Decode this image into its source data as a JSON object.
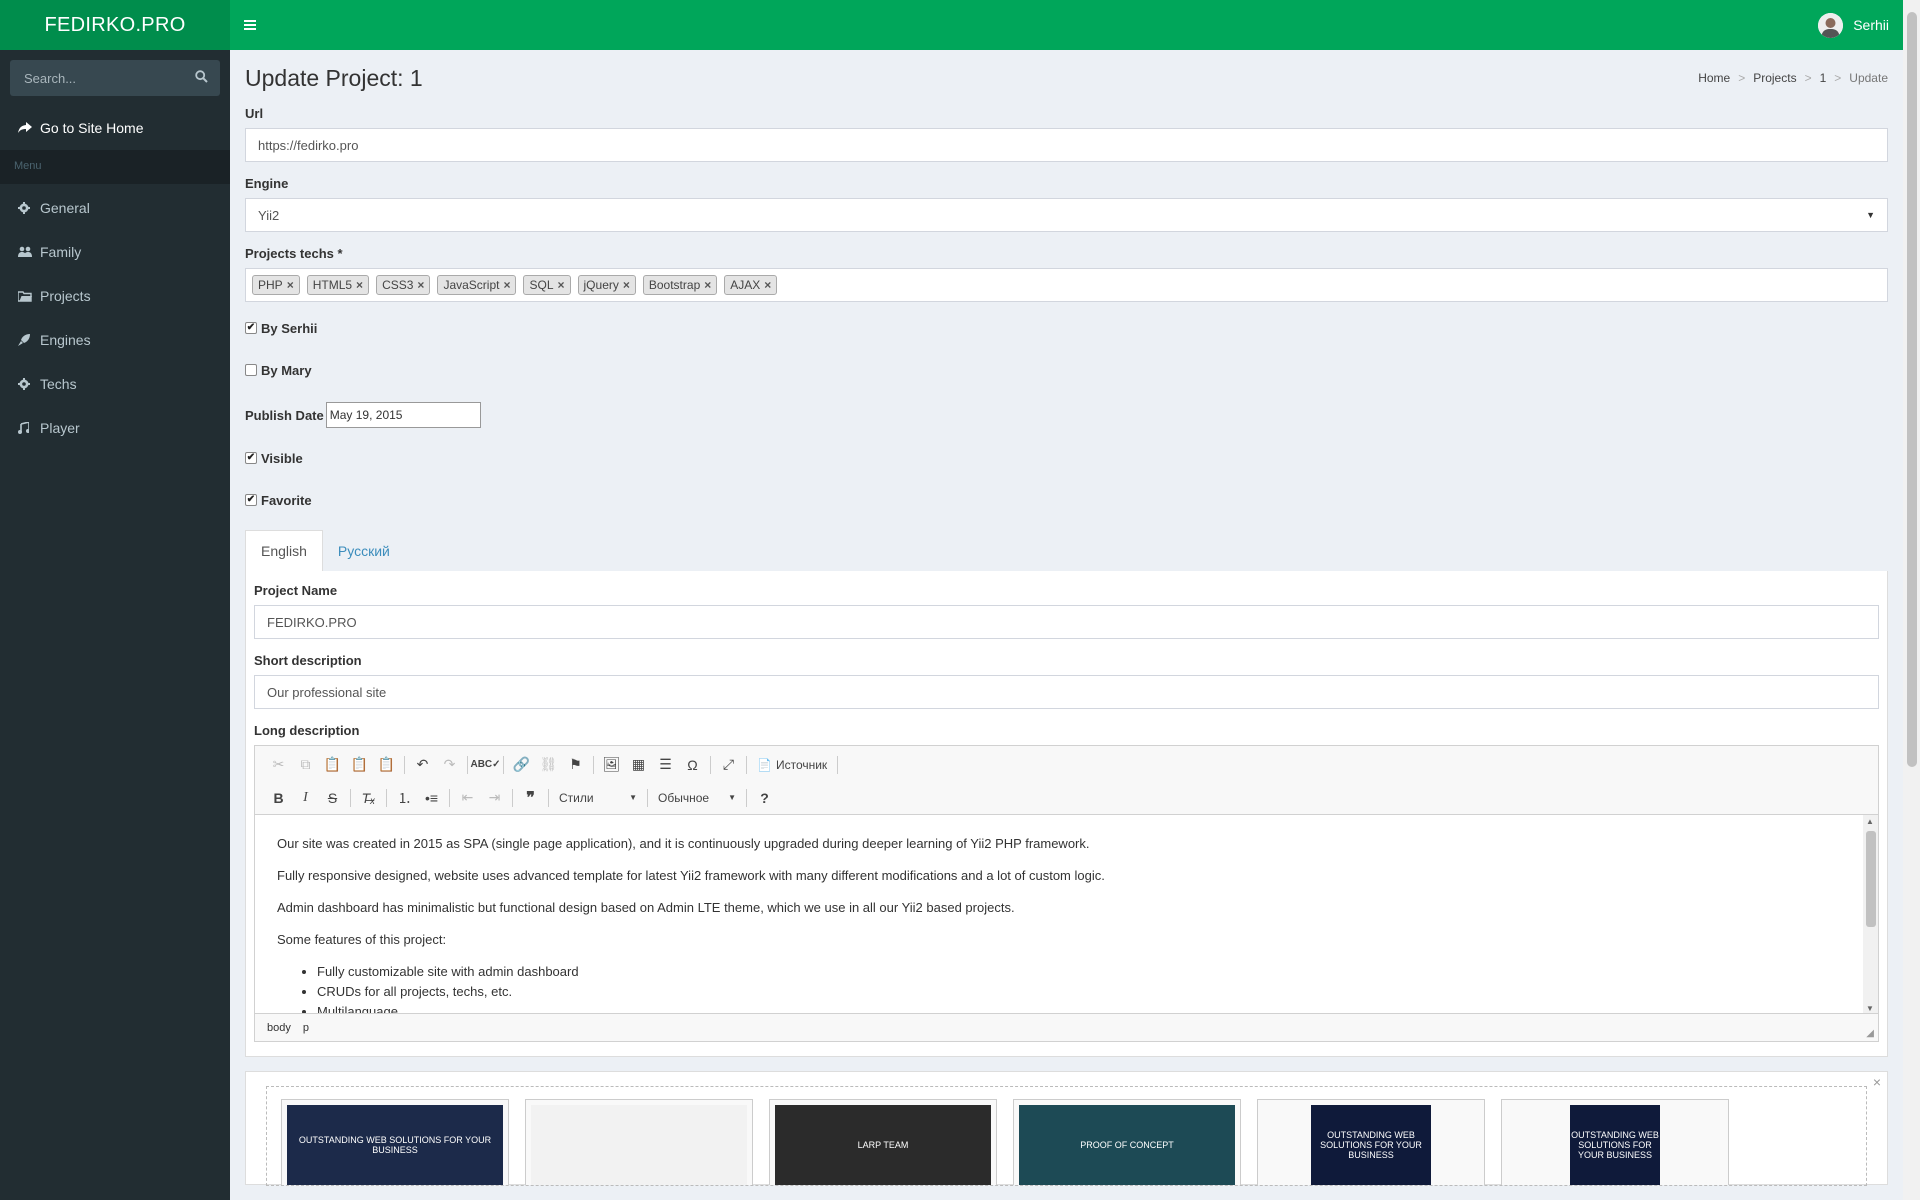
{
  "brand": {
    "logo": "FEDIRKO.PRO"
  },
  "sidebar": {
    "search_placeholder": "Search...",
    "home": "Go to Site Home",
    "menu_header": "Menu",
    "items": [
      {
        "label": "General",
        "icon": "gear-icon"
      },
      {
        "label": "Family",
        "icon": "users-icon"
      },
      {
        "label": "Projects",
        "icon": "folder-icon"
      },
      {
        "label": "Engines",
        "icon": "rocket-icon"
      },
      {
        "label": "Techs",
        "icon": "gear-icon"
      },
      {
        "label": "Player",
        "icon": "music-icon"
      }
    ]
  },
  "topbar": {
    "user_name": "Serhii"
  },
  "page": {
    "title": "Update Project: 1",
    "breadcrumb": [
      "Home",
      "Projects",
      "1",
      "Update"
    ]
  },
  "form": {
    "url": {
      "label": "Url",
      "value": "https://fedirko.pro"
    },
    "engine": {
      "label": "Engine",
      "value": "Yii2"
    },
    "techs": {
      "label": "Projects techs *",
      "tags": [
        "PHP",
        "HTML5",
        "CSS3",
        "JavaScript",
        "SQL",
        "jQuery",
        "Bootstrap",
        "AJAX"
      ]
    },
    "by_serhii": {
      "label": "By Serhii",
      "checked": true
    },
    "by_mary": {
      "label": "By Mary",
      "checked": false
    },
    "publish_date": {
      "label": "Publish Date",
      "value": "May 19, 2015"
    },
    "visible": {
      "label": "Visible",
      "checked": true
    },
    "favorite": {
      "label": "Favorite",
      "checked": true
    }
  },
  "tabs": [
    "English",
    "Русский"
  ],
  "english": {
    "name": {
      "label": "Project Name",
      "value": "FEDIRKO.PRO"
    },
    "short": {
      "label": "Short description",
      "value": "Our professional site"
    },
    "long": {
      "label": "Long description",
      "source_label": "Источник",
      "styles_label": "Стили",
      "format_label": "Обычное",
      "paragraphs": [
        "Our site was created in 2015 as SPA (single page application), and it is continuously upgraded during deeper learning of Yii2 PHP framework.",
        "Fully responsive designed, website uses advanced template for latest Yii2 framework with many different modifications and a lot of custom logic.",
        "Admin dashboard has minimalistic but functional design based on Admin LTE theme, which we use in all our Yii2 based projects.",
        "Some features of this project:"
      ],
      "list": [
        "Fully customizable site with admin dashboard",
        "CRUDs for all projects, techs, etc.",
        "Multilanguage"
      ],
      "status_path": [
        "body",
        "p"
      ]
    }
  },
  "gallery": {
    "thumbs": [
      {
        "bg": "#1c2a4a",
        "text": "OUTSTANDING WEB SOLUTIONS FOR YOUR BUSINESS"
      },
      {
        "bg": "#f2f2f2",
        "text": ""
      },
      {
        "bg": "#2b2b2b",
        "text": "LARP TEAM"
      },
      {
        "bg": "#1d4a55",
        "text": "PROOF OF CONCEPT"
      },
      {
        "bg": "#0f1a3a",
        "text": "OUTSTANDING WEB SOLUTIONS FOR YOUR BUSINESS"
      },
      {
        "bg": "#0f1a3a",
        "text": "OUTSTANDING WEB SOLUTIONS FOR YOUR BUSINESS"
      }
    ]
  },
  "colors": {
    "brand_green": "#00a65a",
    "logo_green": "#008d4c",
    "sidebar_bg": "#222d32",
    "link_blue": "#3c8dbc"
  }
}
